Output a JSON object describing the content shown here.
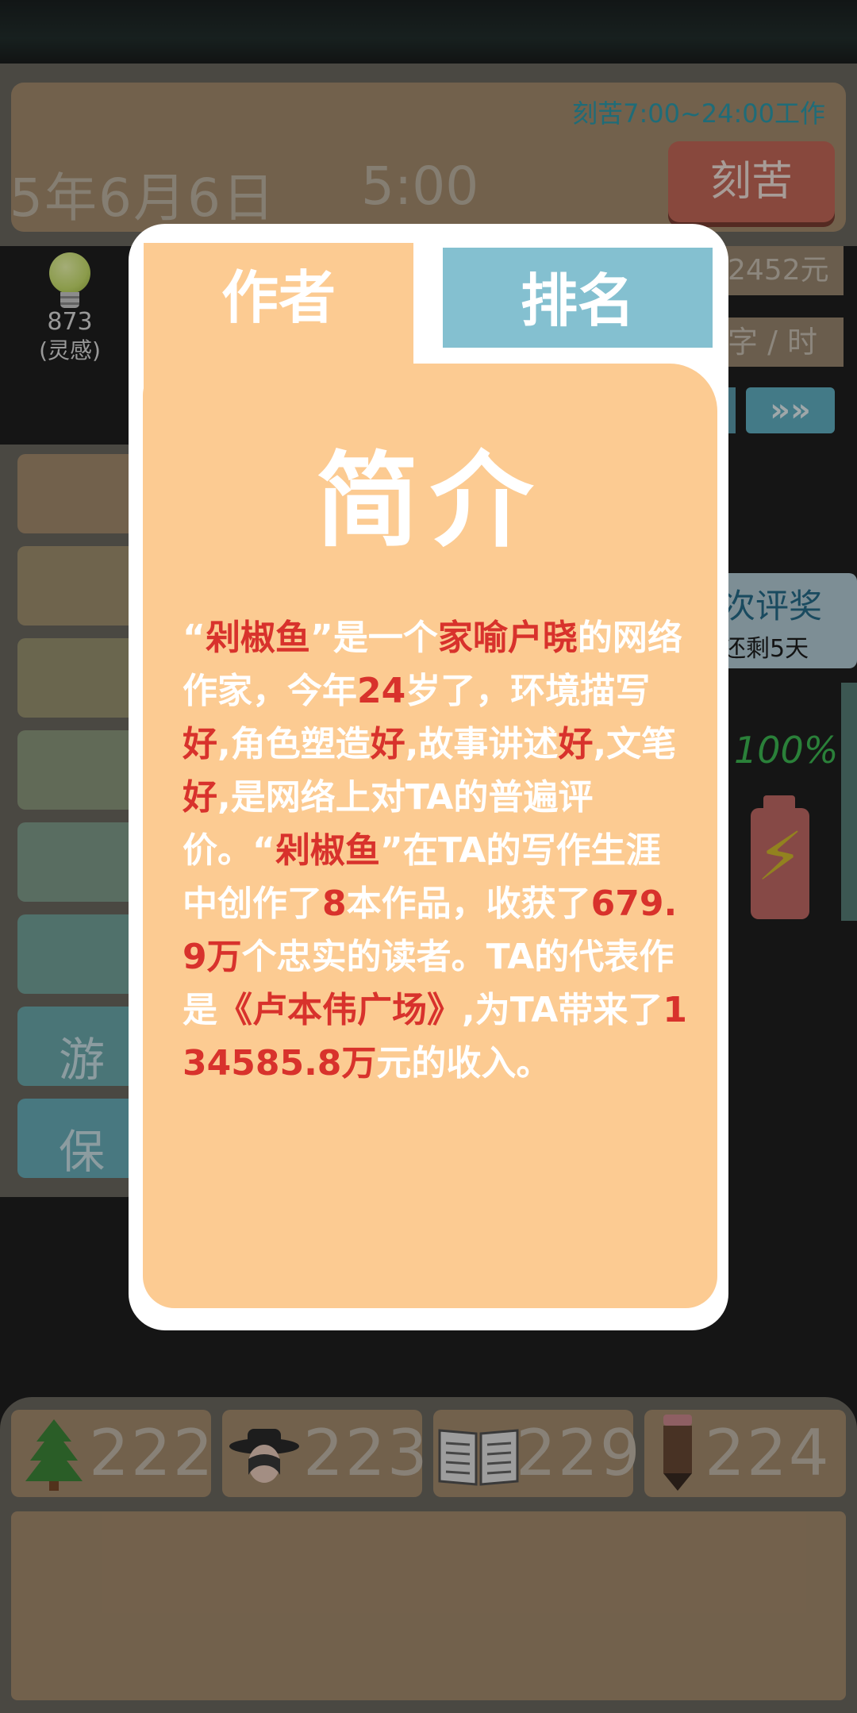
{
  "header": {
    "work_hours": "刻苦7:00~24:00工作",
    "date": "5年6月6日",
    "time": "5:00",
    "work_button": "刻苦"
  },
  "inspiration": {
    "value": "873",
    "label": "(灵感)"
  },
  "side_info": {
    "money": "2452元",
    "speed": "字 / 时",
    "fast_forward": "»»",
    "award_title": "次评奖",
    "award_remaining": "还剩5天",
    "battery_percent": "100%"
  },
  "left_menu": [
    {
      "label": ""
    },
    {
      "label": ""
    },
    {
      "label": ""
    },
    {
      "label": ""
    },
    {
      "label": ""
    },
    {
      "label": ""
    },
    {
      "label": "游"
    },
    {
      "label": "保"
    }
  ],
  "stats": [
    {
      "icon": "tree-icon",
      "value": "222"
    },
    {
      "icon": "reader-icon",
      "value": "223"
    },
    {
      "icon": "book-icon",
      "value": "229"
    },
    {
      "icon": "pencil-icon",
      "value": "224"
    }
  ],
  "modal": {
    "tabs": [
      {
        "label": "作者",
        "active": true
      },
      {
        "label": "排名",
        "active": false
      }
    ],
    "title": "简介",
    "intro": {
      "p1": "“",
      "author": "剁椒鱼",
      "p2": "”是一个",
      "fame": "家喻户晓",
      "p3": "的网络作家，今年",
      "age": "24",
      "p4": "岁了，环境描写",
      "r1": "好",
      "p5": ",角色塑造",
      "r2": "好",
      "p6": ",故事讲述",
      "r3": "好",
      "p7": ",文笔",
      "r4": "好",
      "p8": ",是网络上对TA的普遍评价。“",
      "author2": "剁椒鱼",
      "p9": "”在TA的写作生涯中创作了",
      "works": "8",
      "p10": "本作品，收获了",
      "readers": "679.9万",
      "p11": "个忠实的读者。TA的代表作是",
      "masterpiece": "《卢本伟广场》",
      "p12": ",为TA带来了",
      "income": "134585.8万",
      "p13": "元的收入。"
    }
  },
  "colors": {
    "modal_body": "#fccb92",
    "tab_rank": "#84c0d0",
    "highlight": "#d8322c",
    "panel_brown": "#a98f70"
  }
}
